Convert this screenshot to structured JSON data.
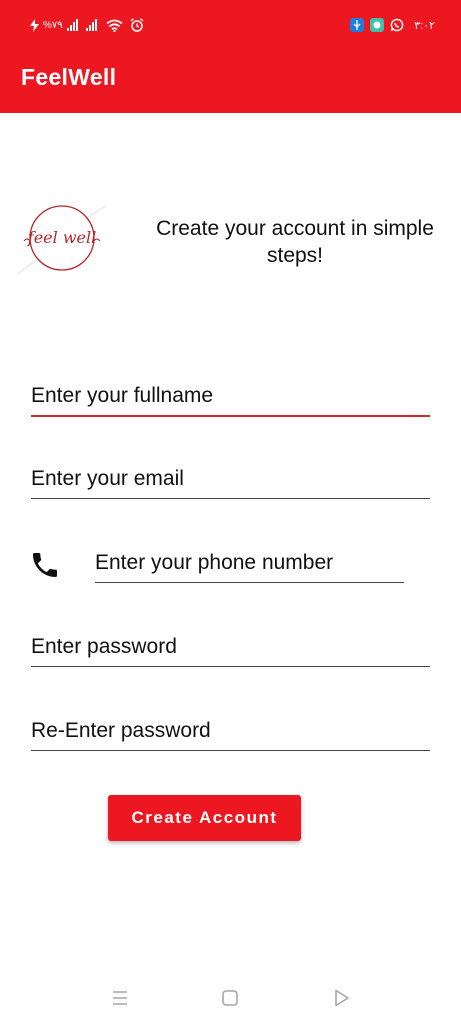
{
  "status_bar": {
    "battery_percent": "%٧٩",
    "time": "٣:٠٢",
    "icons": [
      "charging-icon",
      "signal-icon",
      "signal-icon",
      "wifi-icon",
      "alarm-icon",
      "usb-debug-icon",
      "messaging-app-icon",
      "whatsapp-icon"
    ]
  },
  "app_bar": {
    "title": "FeelWell",
    "color": "#ec1720"
  },
  "hero": {
    "logo_text": "feel well",
    "headline": "Create your account in simple steps!"
  },
  "form": {
    "fullname": {
      "label": "Enter your fullname"
    },
    "email": {
      "label": "Enter your email"
    },
    "phone": {
      "label": "Enter your phone number",
      "icon": "phone-icon"
    },
    "password": {
      "label": "Enter password"
    },
    "reenter_password": {
      "label": "Re-Enter password"
    },
    "submit_label": "Create Account"
  },
  "nav_bar": {
    "icons": [
      "menu-icon",
      "home-icon",
      "back-icon"
    ]
  }
}
